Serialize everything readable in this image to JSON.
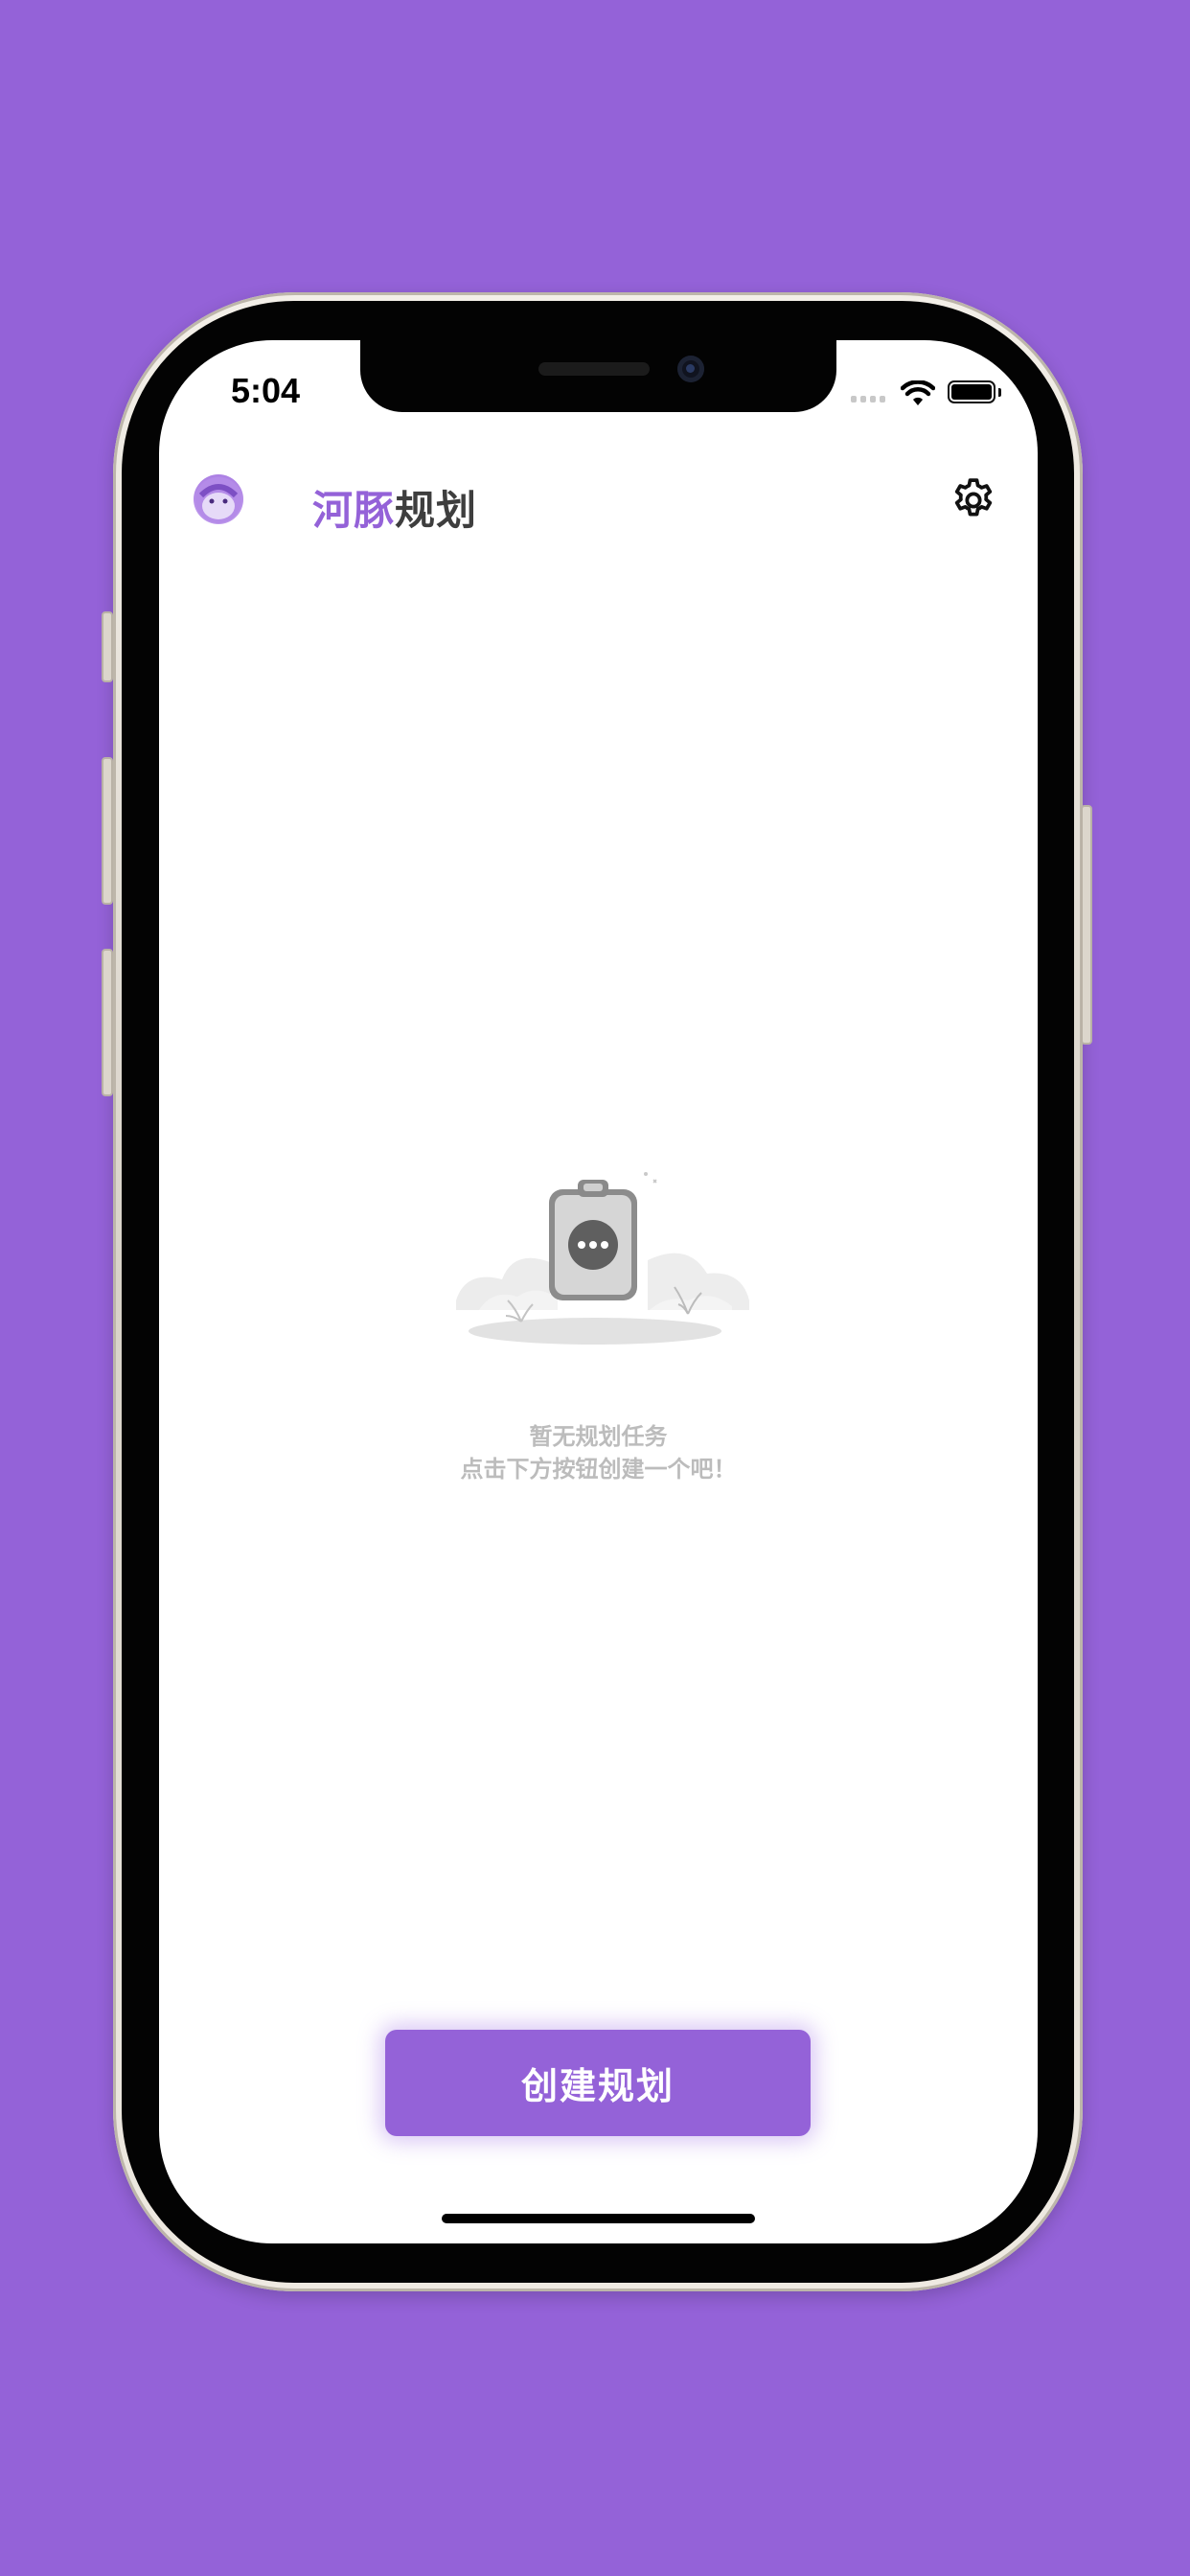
{
  "status_bar": {
    "time": "5:04"
  },
  "header": {
    "avatar_icon": "dolphin-avatar-icon",
    "title_accent": "河豚",
    "title_rest": "规划",
    "settings_icon": "gear-icon"
  },
  "empty_state": {
    "illustration_icon": "clipboard-empty-icon",
    "line1": "暂无规划任务",
    "line2": "点击下方按钮创建一个吧！"
  },
  "actions": {
    "create_label": "创建规划"
  },
  "colors": {
    "accent": "#9462d8",
    "background": "#9462d8",
    "muted_text": "#bcbcbc"
  }
}
